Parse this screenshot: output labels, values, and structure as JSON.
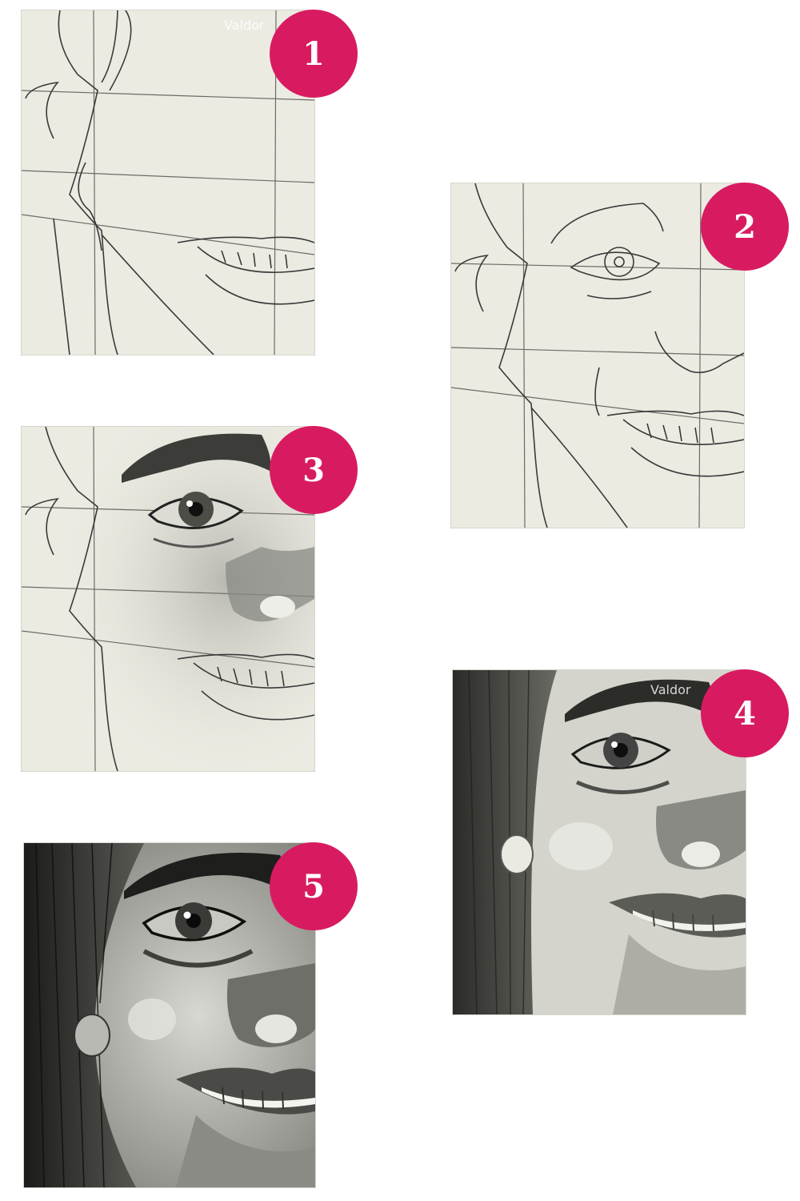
{
  "steps": [
    {
      "number": "1",
      "stage": "grid-outline"
    },
    {
      "number": "2",
      "stage": "outline-eye-nose"
    },
    {
      "number": "3",
      "stage": "shaded-eye-nose"
    },
    {
      "number": "4",
      "stage": "hair-and-shading"
    },
    {
      "number": "5",
      "stage": "finished-portrait"
    }
  ],
  "watermark": "Valdor",
  "colors": {
    "badge": "#d81b60",
    "paper": "#ecebe2",
    "pencil": "#3a3a3a"
  }
}
